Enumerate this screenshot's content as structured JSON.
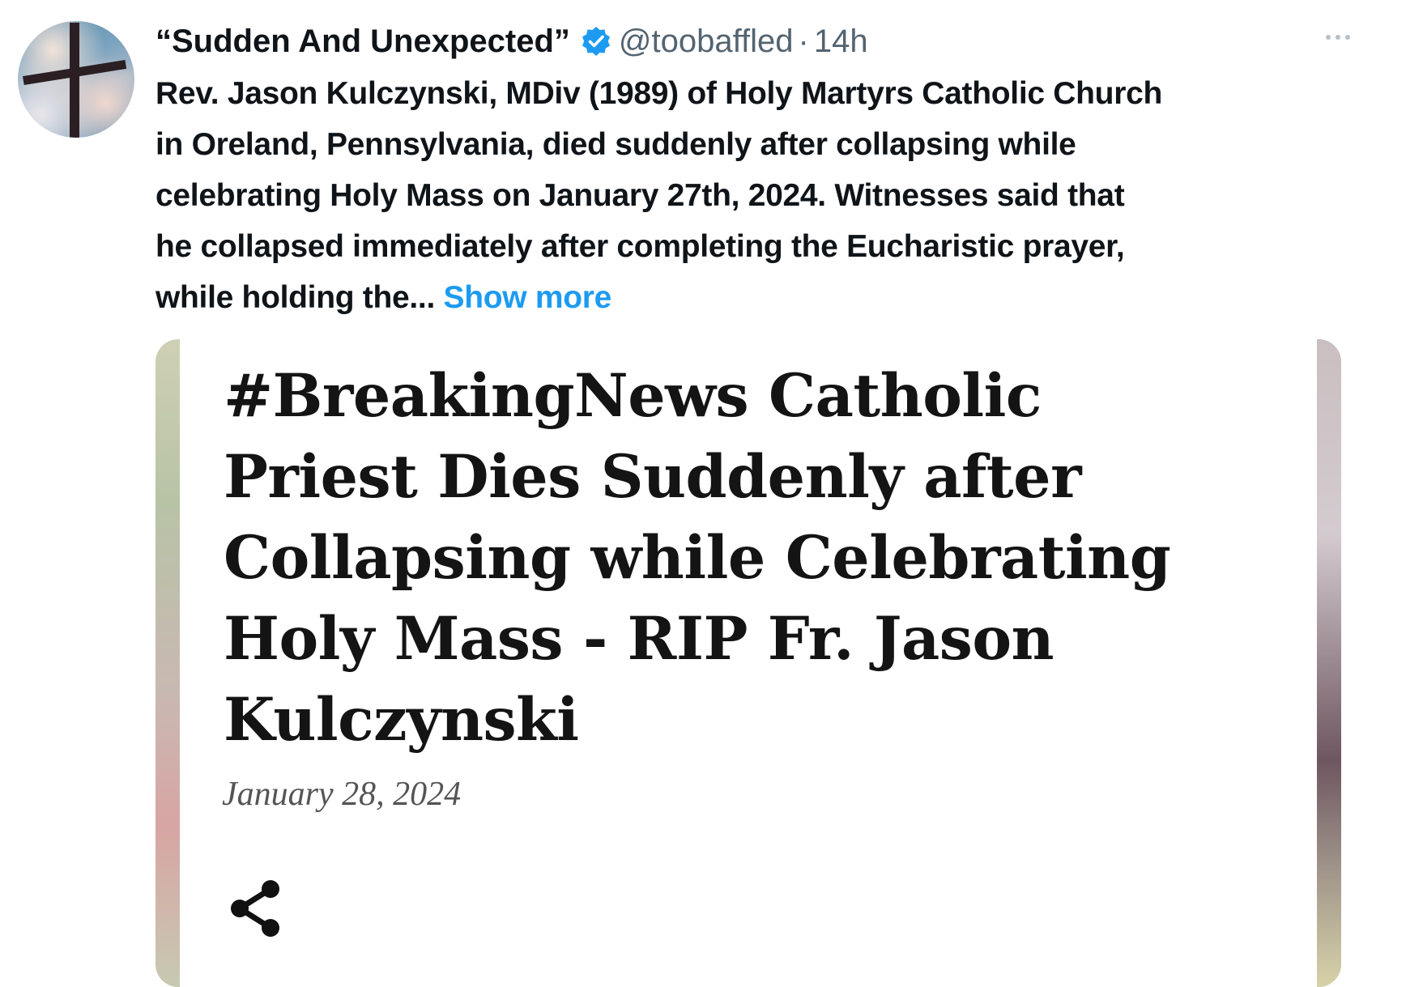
{
  "tweet": {
    "author": {
      "display_name": "“Sudden And Unexpected”",
      "handle": "@toobaffled",
      "separator": "·",
      "time_ago": "14h",
      "verified": true,
      "avatar_icon": "cross-icon"
    },
    "more_icon": "ellipsis-icon",
    "text_lines": [
      "Rev. Jason Kulczynski, MDiv (1989) of Holy Martyrs Catholic Church",
      "in Oreland, Pennsylvania, died suddenly after collapsing while",
      "celebrating Holy Mass on January 27th, 2024. Witnesses said that",
      "he collapsed immediately after completing the Eucharistic prayer,",
      "while holding the... "
    ],
    "show_more_label": "Show more"
  },
  "card": {
    "headline_lines": [
      "#BreakingNews Catholic",
      "Priest Dies Suddenly after",
      "Collapsing while Celebrating",
      "Holy Mass - RIP Fr. Jason",
      "Kulczynski"
    ],
    "date": "January 28, 2024",
    "share_icon": "share-icon"
  },
  "colors": {
    "text": "#0f1419",
    "secondary": "#536471",
    "link": "#1d9bf0",
    "verified_badge": "#1d9bf0"
  }
}
